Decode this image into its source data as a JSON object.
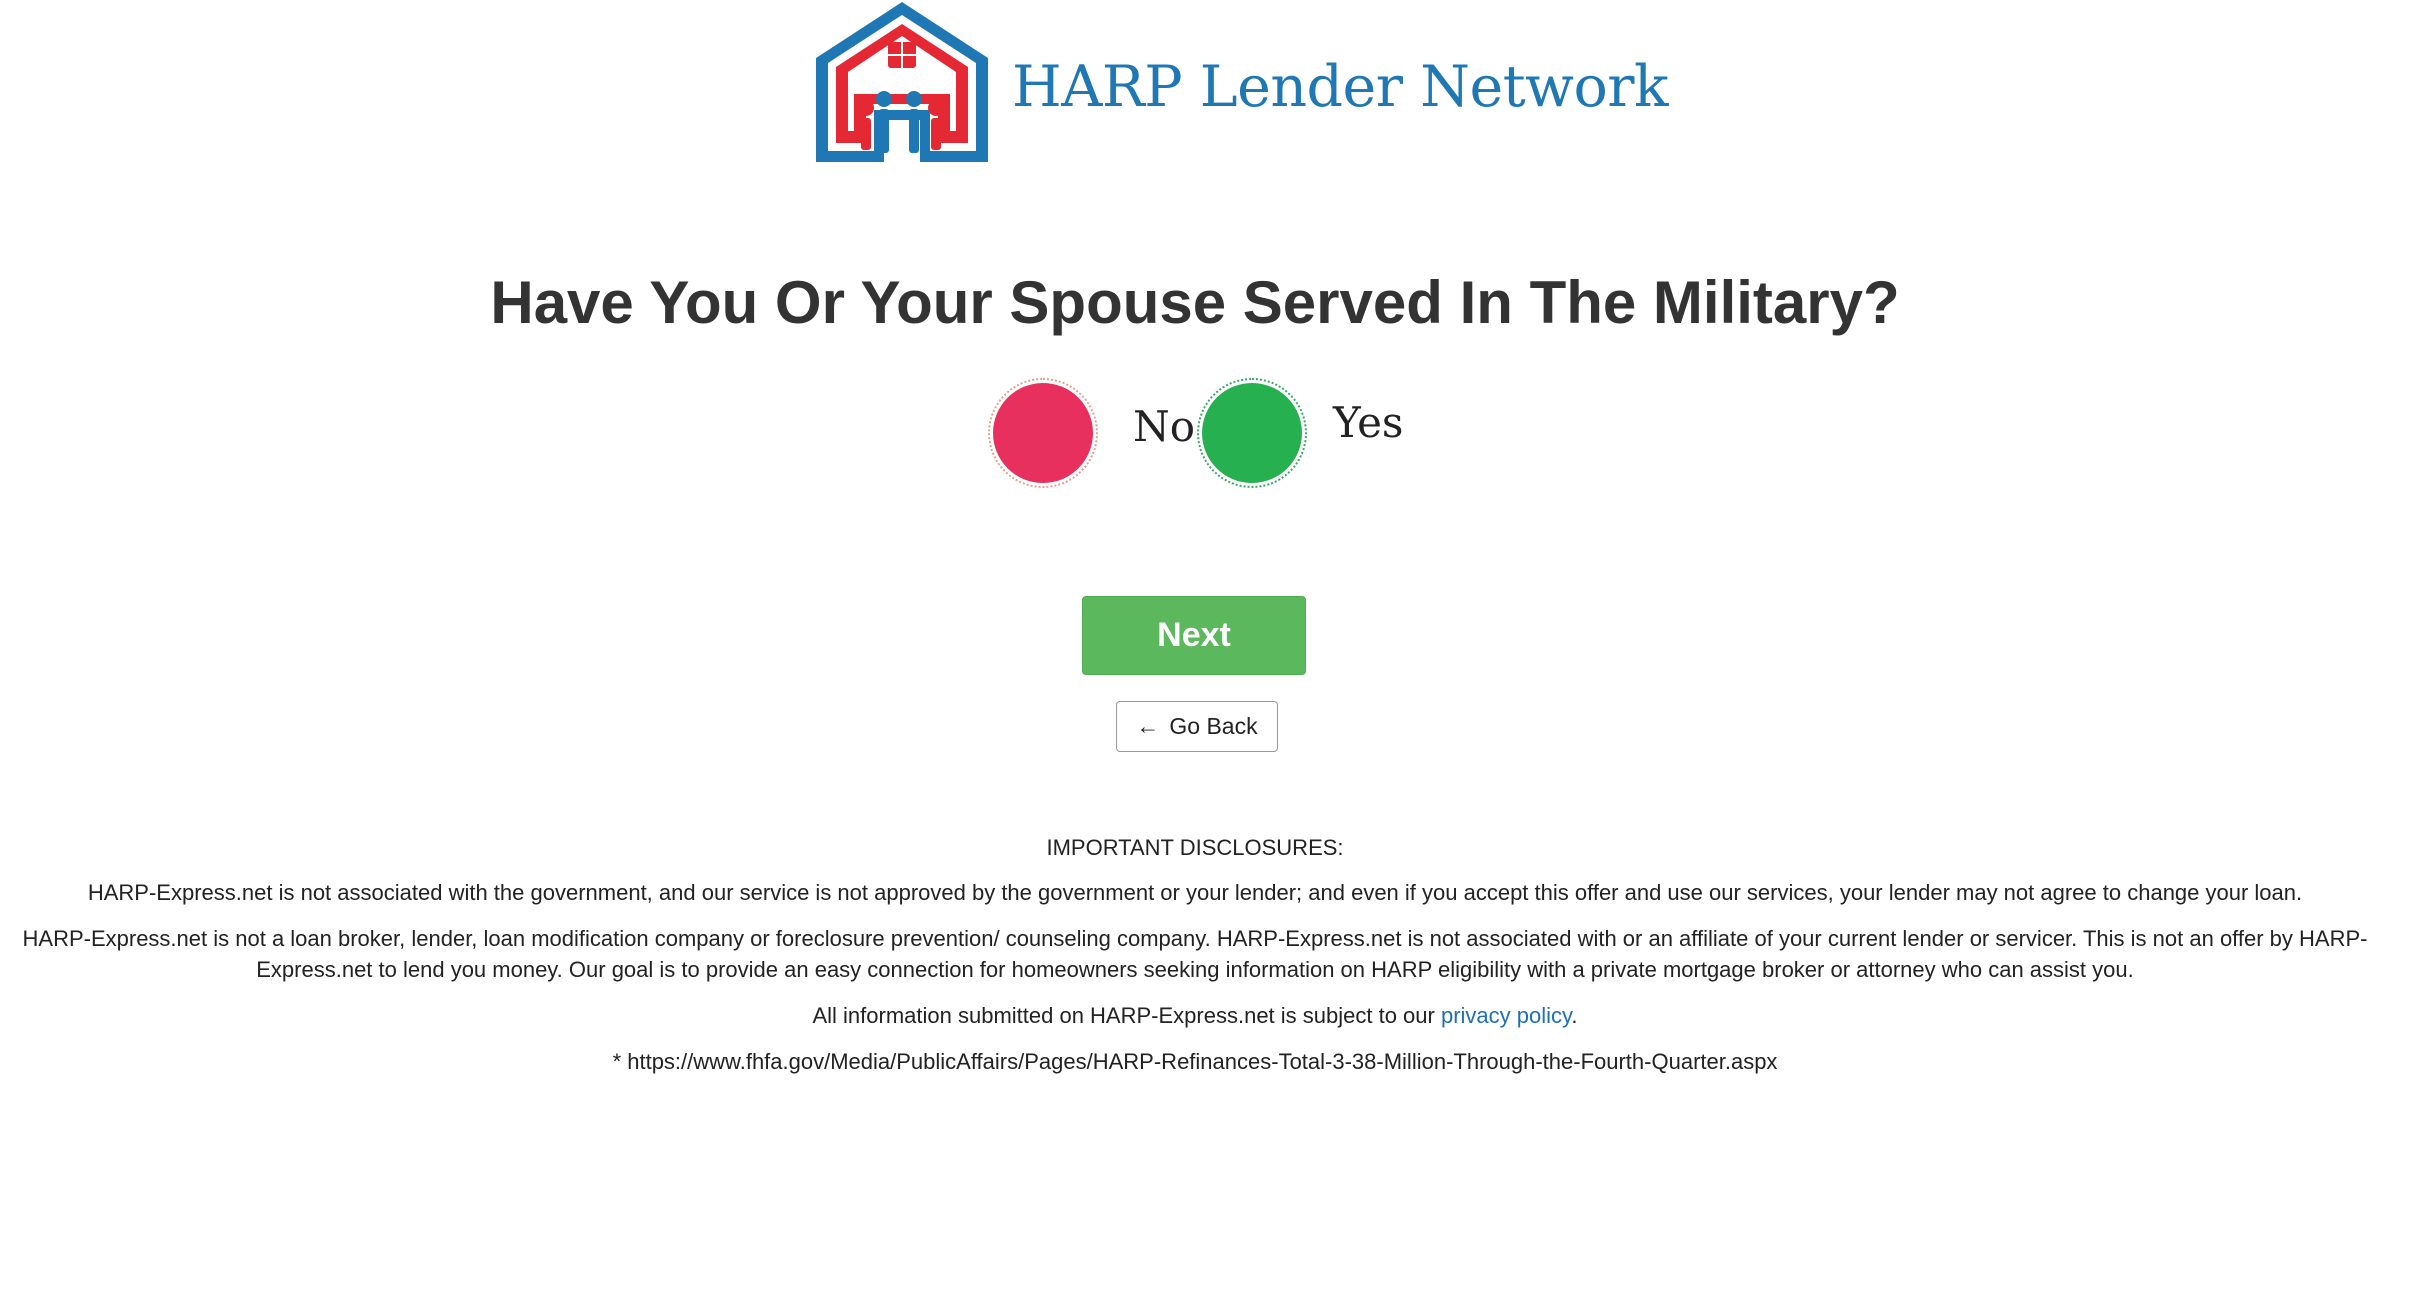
{
  "brand": {
    "name": "HARP Lender Network",
    "colors": {
      "red": "#e52934",
      "blue": "#1f78b4"
    }
  },
  "question": {
    "title": "Have You Or Your Spouse Served In The Military?",
    "options": [
      {
        "label": "No",
        "color": "#e8305f"
      },
      {
        "label": "Yes",
        "color": "#27b04f"
      }
    ]
  },
  "buttons": {
    "next": "Next",
    "back_arrow": "←",
    "back": "Go Back"
  },
  "disclosures": {
    "title": "IMPORTANT DISCLOSURES:",
    "paragraph_1": "HARP-Express.net is not associated with the government, and our service is not approved by the government or your lender; and even if you accept this offer and use our services, your lender may not agree to change your loan.",
    "paragraph_2": "HARP-Express.net is not a loan broker, lender, loan modification company or foreclosure prevention/ counseling company. HARP-Express.net is not associated with or an affiliate of your current lender or servicer. This is not an offer by HARP-Express.net to lend you money. Our goal is to provide an easy connection for homeowners seeking information on HARP eligibility with a private mortgage broker or attorney who can assist you.",
    "privacy_prefix": "All information submitted on HARP-Express.net is subject to our ",
    "privacy_link": "privacy policy",
    "privacy_suffix": ".",
    "source": "* https://www.fhfa.gov/Media/PublicAffairs/Pages/HARP-Refinances-Total-3-38-Million-Through-the-Fourth-Quarter.aspx"
  }
}
